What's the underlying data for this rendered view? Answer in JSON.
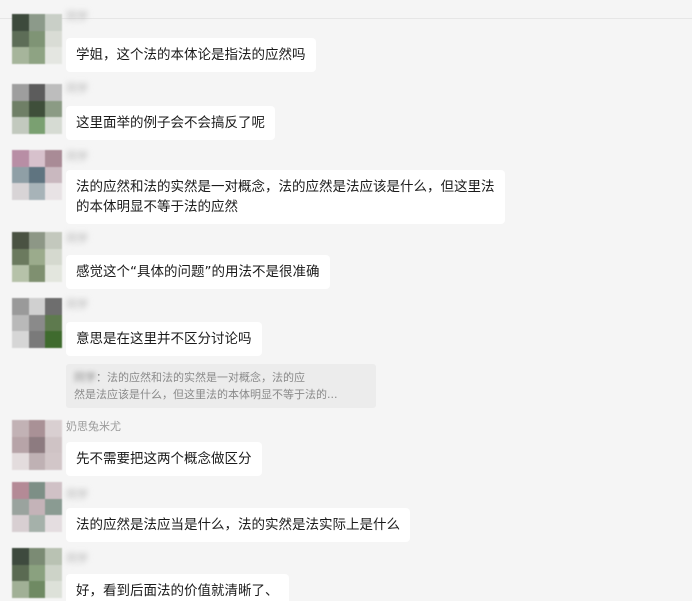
{
  "messages": [
    {
      "id": "m1",
      "nickname": "同学",
      "nickname_blurred": true,
      "lines": [
        "学姐，这个法的本体论是指法的应然吗"
      ],
      "avatar_colors": [
        "#3d4a3c",
        "#8c9a8a",
        "#c9cfc7",
        "#5d6d57",
        "#7f9475",
        "#d9dcd5",
        "#a6b59b",
        "#8ea383",
        "#e4e6e1"
      ]
    },
    {
      "id": "m2",
      "nickname": "同学",
      "nickname_blurred": true,
      "lines": [
        "这里面举的例子会不会搞反了呢"
      ],
      "avatar_colors": [
        "#9e9e9e",
        "#5c5c5c",
        "#bdbdbd",
        "#6f7f66",
        "#3f4f3a",
        "#8b9b84",
        "#c2c9be",
        "#7aa071",
        "#d6dbd3"
      ]
    },
    {
      "id": "m3",
      "nickname": "同学",
      "nickname_blurred": true,
      "lines": [
        "法的应然和法的实然是一对概念，法的应然是法应该是什么，但这里法",
        "的本体明显不等于法的应然"
      ],
      "avatar_colors": [
        "#b88ea5",
        "#d7c1cc",
        "#a98b96",
        "#8f9fa6",
        "#5f7480",
        "#c9b8bf",
        "#d8d4d6",
        "#a7b3b8",
        "#e8e3e5"
      ]
    },
    {
      "id": "m4",
      "nickname": "同学",
      "nickname_blurred": true,
      "lines": [
        "感觉这个“具体的问题”的用法不是很准确"
      ],
      "avatar_colors": [
        "#4a5242",
        "#8d9786",
        "#c3c8bd",
        "#6b7a5e",
        "#9bab8c",
        "#d5d9cf",
        "#b6c2a9",
        "#7f9070",
        "#e3e6de"
      ]
    },
    {
      "id": "m5",
      "nickname": "同学",
      "nickname_blurred": true,
      "lines": [
        "意思是在这里并不区分讨论吗"
      ],
      "avatar_colors": [
        "#9a9a9a",
        "#d0d0d0",
        "#6e6e6e",
        "#b9b9b9",
        "#8a8a8a",
        "#5e7a4e",
        "#d6d6d6",
        "#7a7a7a",
        "#3f6b2e"
      ],
      "quote": {
        "name": "同学",
        "lines": [
          "：法的应然和法的实然是一对概念，法的应",
          "然是法应该是什么，但这里法的本体明显不等于法的..."
        ]
      }
    },
    {
      "id": "m6",
      "nickname": "奶思兔米尤",
      "nickname_blurred": false,
      "lines": [
        "先不需要把这两个概念做区分"
      ],
      "avatar_colors": [
        "#c2b2b5",
        "#a99196",
        "#d9cfd1",
        "#b7a4a8",
        "#8d7b80",
        "#cfc3c5",
        "#e3dcdd",
        "#bfb1b4",
        "#d2c6c8"
      ]
    },
    {
      "id": "m7",
      "nickname": "同学",
      "nickname_blurred": true,
      "lines": [
        "法的应然是法应当是什么，法的实然是法实际上是什么"
      ],
      "avatar_colors": [
        "#b48a96",
        "#7d8f86",
        "#d0c1c6",
        "#9aa39e",
        "#c4b3b8",
        "#8a9b92",
        "#d8cfd2",
        "#a5b1aa",
        "#e4dde0"
      ]
    },
    {
      "id": "m8",
      "nickname": "同学",
      "nickname_blurred": true,
      "lines": [
        "好，看到后面法的价值就清晰了、"
      ],
      "avatar_colors": [
        "#3e4a3e",
        "#7b8b74",
        "#b9c2b3",
        "#5a6a52",
        "#8aa17f",
        "#cdd3c8",
        "#a1b096",
        "#6f8a63",
        "#dde1d9"
      ]
    }
  ]
}
